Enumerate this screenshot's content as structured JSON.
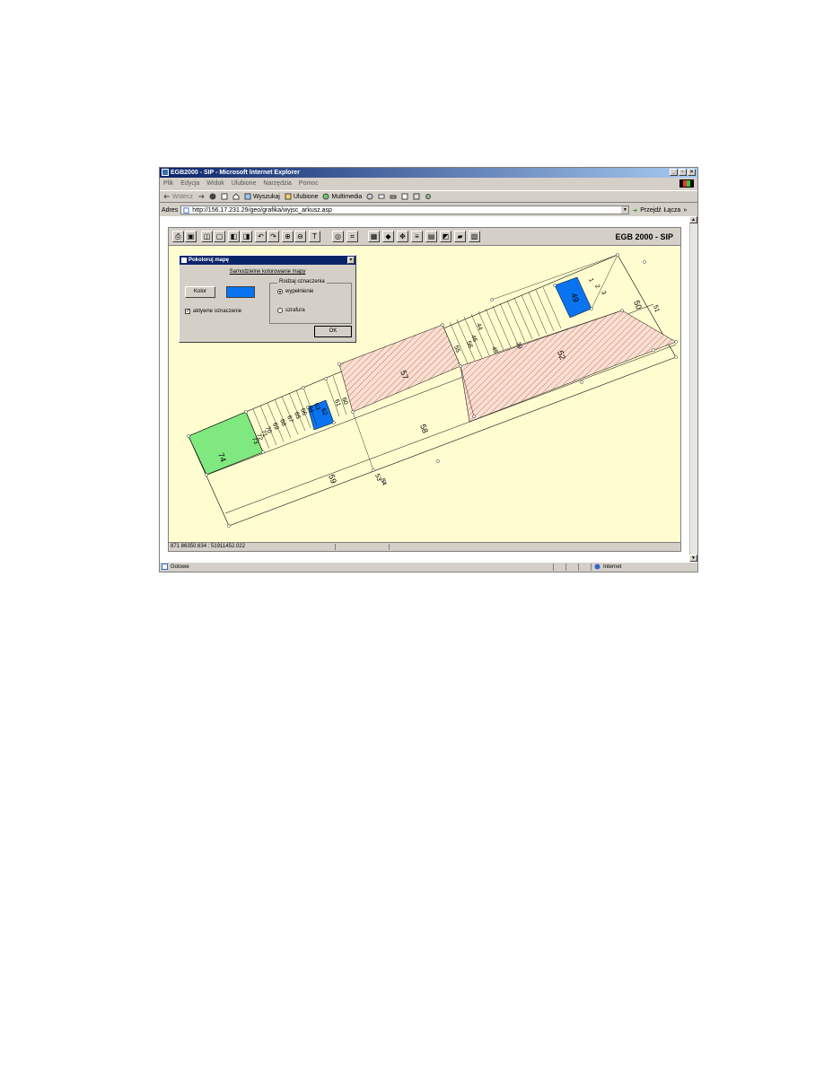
{
  "window": {
    "title": "EGB2000 - SIP - Microsoft Internet Explorer",
    "controls": [
      "_",
      "▫",
      "×"
    ]
  },
  "menu": [
    "Plik",
    "Edycja",
    "Widok",
    "Ulubione",
    "Narzędzia",
    "Pomoc"
  ],
  "toolbar": {
    "back": "Wstecz",
    "search": "Wyszukaj",
    "favorites": "Ulubione",
    "multimedia": "Multimedia"
  },
  "address": {
    "label": "Adres",
    "url": "http://156.17.231.29/geo/grafika/wyjsc_arkusz.asp",
    "go": "Przejdź",
    "links": "Łącza"
  },
  "app": {
    "brand": "EGB 2000 - SIP",
    "coords": "871 86350.634 : 51911452.022",
    "tools": [
      "print-icon",
      "save-icon",
      "fit-icon",
      "page-icon",
      "prev-icon",
      "next-icon",
      "undo-icon",
      "redo-icon",
      "zoom-in-icon",
      "zoom-out-icon",
      "text-icon",
      "search-icon",
      "measure-icon",
      "grid-icon",
      "color-icon",
      "pan-icon",
      "layers-icon",
      "legend-icon",
      "highlight-icon",
      "palette-icon",
      "info-icon"
    ]
  },
  "dialog": {
    "title": "Pokoloruj mapę",
    "heading": "Samodzielne kolorowanie mapy",
    "color_button": "Kolor",
    "swatch_color": "#0a74f0",
    "group_label": "Rodzaj oznaczenia",
    "radio_fill": "wypełnienie",
    "radio_hatch": "szrafura",
    "checkbox_label": "aktywne oznaczenie",
    "ok": "OK"
  },
  "map": {
    "fill_colors": {
      "green": "#7fe87f",
      "blue": "#0a74f0",
      "hatch": "#e0a090"
    },
    "labels": {
      "p74": "74",
      "p59": "59",
      "p58": "58",
      "p57": "57",
      "p52": "52",
      "p50": "50",
      "p49": "49",
      "p51": "51",
      "p53": "53",
      "p54": "54",
      "p55": "55",
      "p56": "56",
      "p60": "60",
      "p61": "61",
      "p62": "62",
      "p63": "63",
      "p64": "64",
      "p65": "65",
      "p66": "66",
      "p67": "67",
      "p68": "68",
      "p69": "69",
      "p70": "70",
      "p71": "71",
      "p72": "72",
      "p73": "73",
      "p1": "1",
      "p2": "2",
      "p3": "3",
      "p44": "44",
      "p45": "45",
      "p46": "46",
      "p39": "39"
    }
  },
  "status": {
    "text": "Gotowe",
    "zone": "Internet"
  }
}
